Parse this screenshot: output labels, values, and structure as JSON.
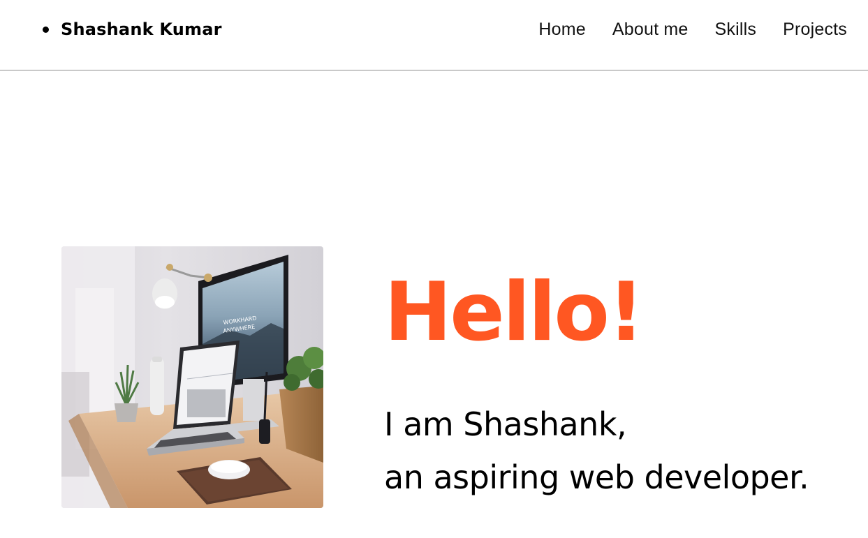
{
  "header": {
    "brand_name": "Shashank Kumar",
    "nav": [
      {
        "label": "Home"
      },
      {
        "label": "About me"
      },
      {
        "label": "Skills"
      },
      {
        "label": "Projects"
      }
    ]
  },
  "hero": {
    "greeting": "Hello!",
    "intro_line_1": "I am Shashank,",
    "intro_line_2": "an aspiring web developer.",
    "monitor_screen_text_1": "WORKHARD",
    "monitor_screen_text_2": "ANYWHERE",
    "accent_color": "#ff5722"
  }
}
